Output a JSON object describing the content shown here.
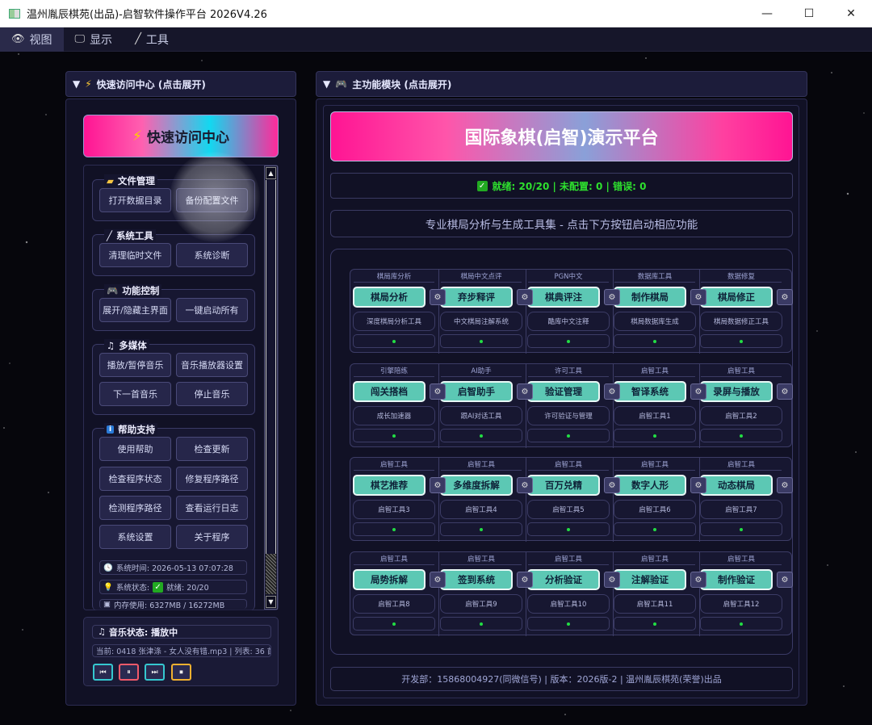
{
  "window": {
    "title": "温州胤辰棋苑(出品)-启智软件操作平台 2026V4.26",
    "minimize": "—",
    "maximize": "☐",
    "close": "✕"
  },
  "menubar": [
    {
      "label": "视图",
      "icon": "eye-icon"
    },
    {
      "label": "显示",
      "icon": "monitor-icon"
    },
    {
      "label": "工具",
      "icon": "wand-icon"
    }
  ],
  "left_panel": {
    "header": "快速访问中心 (点击展开)",
    "banner": "快速访问中心",
    "groups": {
      "file": {
        "title": "文件管理",
        "buttons": [
          "打开数据目录",
          "备份配置文件"
        ]
      },
      "system": {
        "title": "系统工具",
        "buttons": [
          "清理临时文件",
          "系统诊断"
        ]
      },
      "control": {
        "title": "功能控制",
        "buttons": [
          "展开/隐藏主界面",
          "一键启动所有"
        ]
      },
      "media": {
        "title": "多媒体",
        "buttons": [
          "播放/暂停音乐",
          "音乐播放器设置",
          "下一首音乐",
          "停止音乐"
        ]
      },
      "help": {
        "title": "帮助支持",
        "buttons": [
          "使用帮助",
          "检查更新",
          "检查程序状态",
          "修复程序路径",
          "检测程序路径",
          "查看运行日志",
          "系统设置",
          "关于程序"
        ]
      }
    },
    "sysinfo": {
      "time": "系统时间: 2026-05-13 07:07:28",
      "status_label": "系统状态:",
      "status_value": "就绪: 20/20",
      "memory": "内存使用: 6327MB / 16272MB"
    },
    "music": {
      "status": "音乐状态: 播放中",
      "now_playing": "当前: 0418 张津涤 - 女人没有错.mp3 | 列表: 36 首",
      "controls": [
        {
          "icon": "prev-icon",
          "glyph": "⏮",
          "color": "#35c8d0"
        },
        {
          "icon": "pause-icon",
          "glyph": "⏸",
          "color": "#f05a6a"
        },
        {
          "icon": "next-icon",
          "glyph": "⏭",
          "color": "#35c8d0"
        },
        {
          "icon": "stop-icon",
          "glyph": "⏹",
          "color": "#f0b030"
        }
      ]
    }
  },
  "main_panel": {
    "header": "主功能模块 (点击展开)",
    "banner": "国际象棋(启智)演示平台",
    "status": "就绪: 20/20 | 未配置: 0 | 错误: 0",
    "subtitle": "专业棋局分析与生成工具集 - 点击下方按钮启动相应功能",
    "rows": [
      [
        {
          "cat": "棋局库分析",
          "btn": "棋局分析",
          "desc": "深度棋局分析工具"
        },
        {
          "cat": "棋局中文点评",
          "btn": "弃步释评",
          "desc": "中文棋局注解系统"
        },
        {
          "cat": "PGN中文",
          "btn": "棋典评注",
          "desc": "酷库中文注释"
        },
        {
          "cat": "数据库工具",
          "btn": "制作棋局",
          "desc": "棋局数据库生成"
        },
        {
          "cat": "数据修复",
          "btn": "棋局修正",
          "desc": "棋局数据修正工具"
        }
      ],
      [
        {
          "cat": "引擎陪练",
          "btn": "闯关搭档",
          "desc": "成长加速器"
        },
        {
          "cat": "AI助手",
          "btn": "启智助手",
          "desc": "跟AI对话工具"
        },
        {
          "cat": "许可工具",
          "btn": "验证管理",
          "desc": "许可验证与管理"
        },
        {
          "cat": "启智工具",
          "btn": "智译系统",
          "desc": "启智工具1"
        },
        {
          "cat": "启智工具",
          "btn": "录屏与播放",
          "desc": "启智工具2"
        }
      ],
      [
        {
          "cat": "启智工具",
          "btn": "棋艺推荐",
          "desc": "启智工具3"
        },
        {
          "cat": "启智工具",
          "btn": "多维度拆解",
          "desc": "启智工具4"
        },
        {
          "cat": "启智工具",
          "btn": "百万兑精",
          "desc": "启智工具5"
        },
        {
          "cat": "启智工具",
          "btn": "数字人形",
          "desc": "启智工具6"
        },
        {
          "cat": "启智工具",
          "btn": "动态棋局",
          "desc": "启智工具7"
        }
      ],
      [
        {
          "cat": "启智工具",
          "btn": "局势拆解",
          "desc": "启智工具8"
        },
        {
          "cat": "启智工具",
          "btn": "签到系统",
          "desc": "启智工具9"
        },
        {
          "cat": "启智工具",
          "btn": "分析验证",
          "desc": "启智工具10"
        },
        {
          "cat": "启智工具",
          "btn": "注解验证",
          "desc": "启智工具11"
        },
        {
          "cat": "启智工具",
          "btn": "制作验证",
          "desc": "启智工具12"
        }
      ]
    ],
    "footer": "开发部：15868004927(同微信号) | 版本：2026版-2 | 温州胤辰棋苑(荣誉)出品"
  }
}
